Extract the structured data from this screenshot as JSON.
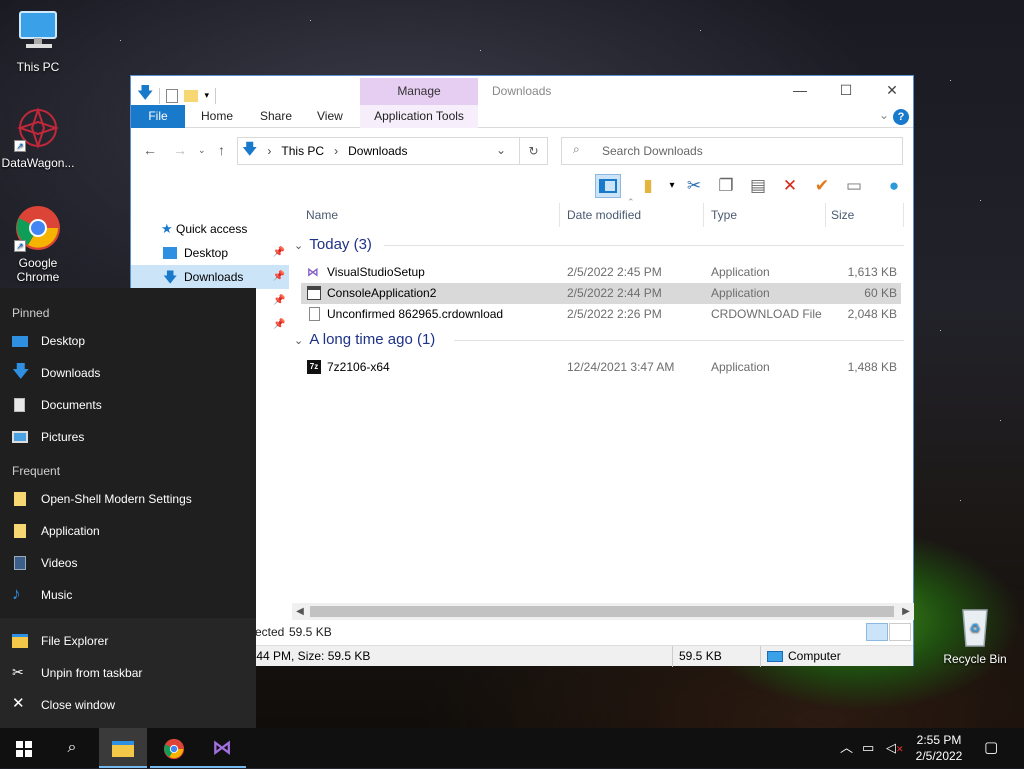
{
  "desktop": {
    "icons": [
      {
        "label": "This PC"
      },
      {
        "label": "DataWagon..."
      },
      {
        "label": "Google Chrome"
      },
      {
        "label": "Recycle Bin"
      }
    ]
  },
  "explorer": {
    "title": "Downloads",
    "contextual_tab": "Manage",
    "ribbon_tabs": [
      "File",
      "Home",
      "Share",
      "View",
      "Application Tools"
    ],
    "address": {
      "root": "This PC",
      "current": "Downloads"
    },
    "search_placeholder": "Search Downloads",
    "nav": [
      {
        "label": "Quick access"
      },
      {
        "label": "Desktop"
      },
      {
        "label": "Downloads"
      }
    ],
    "columns": [
      "Name",
      "Date modified",
      "Type",
      "Size"
    ],
    "groups": [
      {
        "title": "Today (3)",
        "files": [
          {
            "name": "VisualStudioSetup",
            "date": "2/5/2022 2:45 PM",
            "type": "Application",
            "size": "1,613 KB"
          },
          {
            "name": "ConsoleApplication2",
            "date": "2/5/2022 2:44 PM",
            "type": "Application",
            "size": "60 KB"
          },
          {
            "name": "Unconfirmed 862965.crdownload",
            "date": "2/5/2022 2:26 PM",
            "type": "CRDOWNLOAD File",
            "size": "2,048 KB"
          }
        ]
      },
      {
        "title": "A long time ago (1)",
        "files": [
          {
            "name": "7z2106-x64",
            "date": "12/24/2021 3:47 AM",
            "type": "Application",
            "size": "1,488 KB"
          }
        ]
      }
    ],
    "status": {
      "selected_partial": "ected",
      "selected_size": "59.5 KB",
      "details_partial": ":44 PM, Size: 59.5 KB",
      "size": "59.5 KB",
      "location": "Computer"
    }
  },
  "jumplist": {
    "pinned_header": "Pinned",
    "pinned": [
      "Desktop",
      "Downloads",
      "Documents",
      "Pictures"
    ],
    "frequent_header": "Frequent",
    "frequent": [
      "Open-Shell Modern Settings",
      "Application",
      "Videos",
      "Music"
    ],
    "tasks": [
      "File Explorer",
      "Unpin from taskbar",
      "Close window"
    ]
  },
  "taskbar": {
    "time": "2:55 PM",
    "date": "2/5/2022"
  },
  "colors": {
    "accent": "#1979ca",
    "manage_tab": "#e6cdf2",
    "selection": "#d9d9d9",
    "nav_selected": "#cce4f7"
  }
}
